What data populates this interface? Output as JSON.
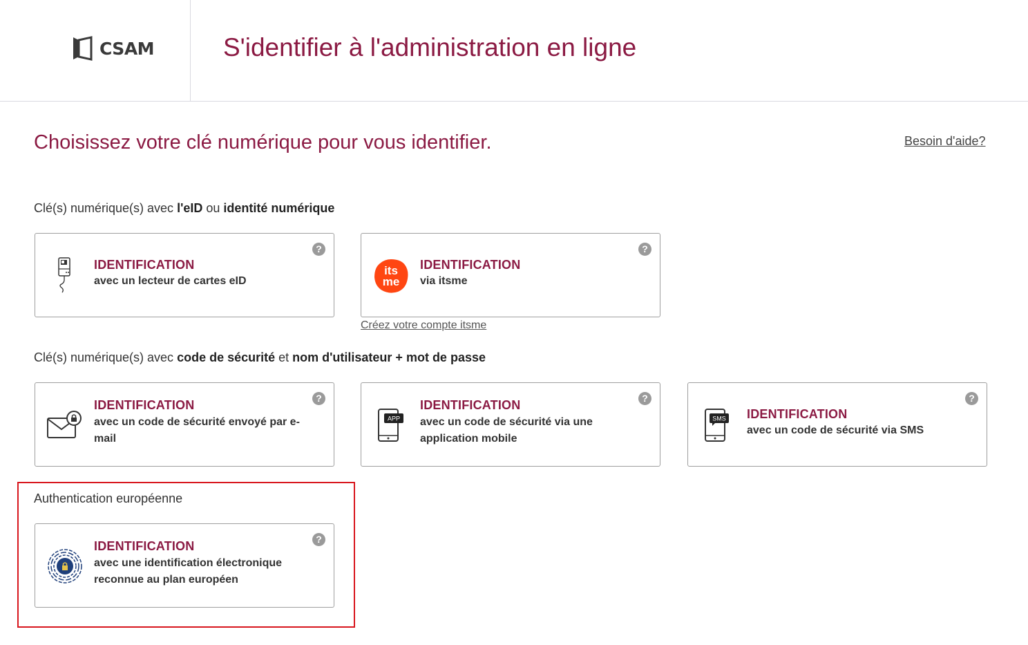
{
  "header": {
    "logo_text": "CSAM",
    "title": "S'identifier à l'administration en ligne"
  },
  "main": {
    "heading": "Choisissez votre clé numérique pour vous identifier.",
    "help_link": "Besoin d'aide?"
  },
  "sections": {
    "eid": {
      "label_prefix": "Clé(s) numérique(s) avec ",
      "label_bold1": "l'eID",
      "label_mid": " ou ",
      "label_bold2": "identité numérique"
    },
    "code": {
      "label_prefix": "Clé(s) numérique(s) avec ",
      "label_bold1": "code de sécurité",
      "label_mid": " et ",
      "label_bold2": "nom d'utilisateur + mot de passe"
    },
    "europe": {
      "label": "Authentication européenne"
    }
  },
  "cards": {
    "eid_reader": {
      "title": "IDENTIFICATION",
      "desc": "avec un lecteur de cartes eID",
      "icon": "card-reader-icon"
    },
    "itsme": {
      "title": "IDENTIFICATION",
      "desc": "via itsme",
      "icon": "itsme-icon",
      "icon_text_top": "its",
      "icon_text_bottom": "me",
      "sub_link": "Créez votre compte itsme"
    },
    "email": {
      "title": "IDENTIFICATION",
      "desc": "avec un code de sécurité envoyé par e-mail",
      "icon": "email-lock-icon"
    },
    "app": {
      "title": "IDENTIFICATION",
      "desc": "avec un code de sécurité via une application mobile",
      "icon": "phone-app-icon",
      "icon_badge": "APP"
    },
    "sms": {
      "title": "IDENTIFICATION",
      "desc": "avec un code de sécurité via SMS",
      "icon": "phone-sms-icon",
      "icon_badge": "SMS"
    },
    "eidas": {
      "title": "IDENTIFICATION",
      "desc": "avec une identification électronique reconnue au plan européen",
      "icon": "eidas-icon"
    }
  },
  "help_icon": "?",
  "colors": {
    "accent": "#8b1a43",
    "highlight_border": "#d8161d",
    "itsme": "#ff4612"
  }
}
